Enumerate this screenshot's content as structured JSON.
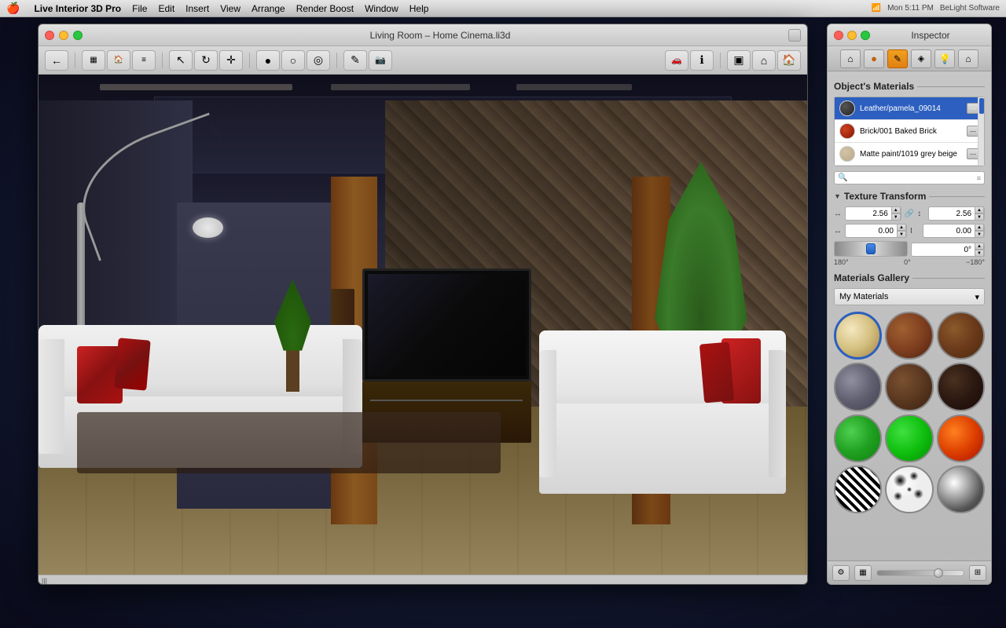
{
  "menubar": {
    "apple": "🍎",
    "app_name": "Live Interior 3D Pro",
    "menus": [
      "File",
      "Edit",
      "Insert",
      "View",
      "Arrange",
      "Render Boost",
      "Window",
      "Help"
    ],
    "status_right": "Mon 5:11 PM",
    "company": "BeLight Software"
  },
  "main_window": {
    "title": "Living Room – Home Cinema.li3d",
    "traffic_lights": [
      "close",
      "minimize",
      "maximize"
    ]
  },
  "toolbar": {
    "buttons": [
      {
        "name": "back",
        "icon": "←"
      },
      {
        "name": "floor-plan",
        "icon": "▦"
      },
      {
        "name": "render-view",
        "icon": "🏠"
      },
      {
        "name": "3d-view",
        "icon": "≡"
      },
      {
        "name": "separator"
      },
      {
        "name": "select",
        "icon": "↖"
      },
      {
        "name": "orbit",
        "icon": "↻"
      },
      {
        "name": "pan",
        "icon": "✛"
      },
      {
        "name": "separator"
      },
      {
        "name": "sphere",
        "icon": "●"
      },
      {
        "name": "circle",
        "icon": "○"
      },
      {
        "name": "torus",
        "icon": "◎"
      },
      {
        "name": "separator"
      },
      {
        "name": "draw",
        "icon": "✎"
      },
      {
        "name": "camera",
        "icon": "📷"
      },
      {
        "name": "separator"
      },
      {
        "name": "object-tool",
        "icon": "🚗"
      },
      {
        "name": "info",
        "icon": "ℹ"
      },
      {
        "name": "separator"
      },
      {
        "name": "frame-select",
        "icon": "▣"
      },
      {
        "name": "home-view",
        "icon": "⌂"
      },
      {
        "name": "3d-glasses",
        "icon": "🏠"
      }
    ]
  },
  "inspector": {
    "title": "Inspector",
    "toolbar_buttons": [
      {
        "name": "house-btn",
        "icon": "🏠",
        "active": false
      },
      {
        "name": "sphere-btn",
        "icon": "●",
        "active": false
      },
      {
        "name": "paint-btn",
        "icon": "✎",
        "active": true
      },
      {
        "name": "texture-btn",
        "icon": "◈",
        "active": false
      },
      {
        "name": "light-btn",
        "icon": "💡",
        "active": false
      },
      {
        "name": "object-btn",
        "icon": "⌂",
        "active": false
      }
    ],
    "objects_materials": {
      "title": "Object's Materials",
      "items": [
        {
          "name": "Leather/pamela_09014",
          "type": "dark",
          "selected": true
        },
        {
          "name": "Brick/001 Baked Brick",
          "type": "red"
        },
        {
          "name": "Matte paint/1019 grey beige",
          "type": "beige"
        }
      ]
    },
    "texture_transform": {
      "title": "Texture Transform",
      "width_value": "2.56",
      "height_value": "2.56",
      "offset_x": "0.00",
      "offset_y": "0.00",
      "rotation_value": "0°",
      "rotation_min": "180°",
      "rotation_mid": "0°",
      "rotation_max": "−180°"
    },
    "materials_gallery": {
      "title": "Materials Gallery",
      "dropdown_value": "My Materials",
      "items": [
        {
          "name": "cream-sphere",
          "type": "cream",
          "selected": true
        },
        {
          "name": "wood-light",
          "type": "wood1"
        },
        {
          "name": "wood-dark",
          "type": "wood2"
        },
        {
          "name": "stone-grey",
          "type": "stone"
        },
        {
          "name": "brown-mid",
          "type": "brown"
        },
        {
          "name": "dark-brown",
          "type": "dark-brown"
        },
        {
          "name": "green-light",
          "type": "green1"
        },
        {
          "name": "green-dark",
          "type": "green2"
        },
        {
          "name": "fire-red",
          "type": "fire"
        },
        {
          "name": "zebra-pattern",
          "type": "zebra"
        },
        {
          "name": "spots-pattern",
          "type": "spots"
        },
        {
          "name": "chrome-metal",
          "type": "chrome"
        }
      ]
    }
  },
  "status": {
    "scroll_indicator": "|||"
  }
}
